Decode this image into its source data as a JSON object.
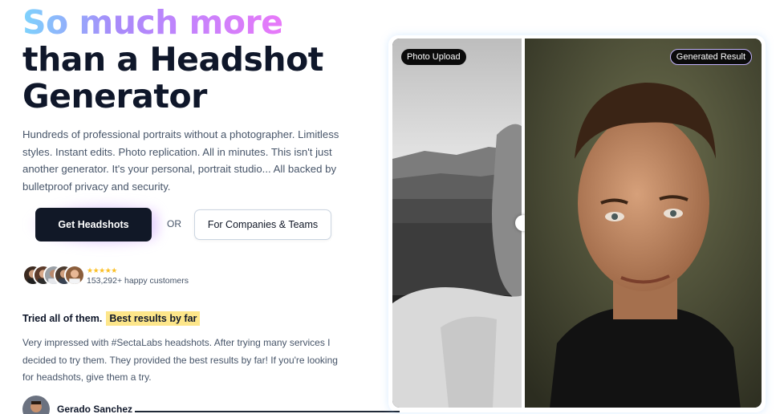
{
  "hero": {
    "headline_line1": "So much more",
    "headline_line2": "than a Headshot",
    "headline_line3": "Generator",
    "description": "Hundreds of professional portraits without a photographer. Limitless styles. Instant edits. Photo replication. All in minutes. This isn't just another generator. It's your personal, portrait studio... All backed by bulletproof privacy and security."
  },
  "cta": {
    "primary_label": "Get Headshots",
    "or_label": "OR",
    "secondary_label": "For Companies & Teams"
  },
  "social_proof": {
    "stars": "★★★★★",
    "customers": "153,292+ happy customers"
  },
  "review": {
    "title": "Tried all of them.",
    "highlight": "Best results by far",
    "text": "Very impressed with #SectaLabs headshots. After trying many services I decided to try them. They provided the best results by far! If you're looking for headshots, give them a try.",
    "reviewer_name": "Gerado Sanchez"
  },
  "comparison": {
    "left_badge": "Photo Upload",
    "right_badge": "Generated Result"
  },
  "colors": {
    "gradient": [
      "#7dd3fc",
      "#a78bfa",
      "#c084fc",
      "#e879f9"
    ],
    "primary_button": "#111827",
    "highlight": "#fde68a",
    "star": "#fbbf24"
  }
}
